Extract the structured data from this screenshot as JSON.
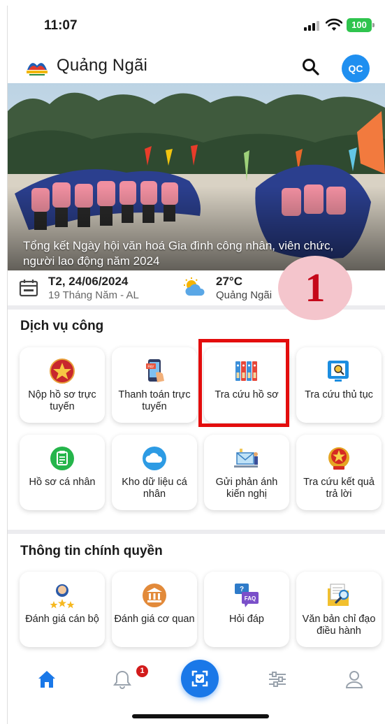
{
  "status_bar": {
    "time": "11:07",
    "battery": "100"
  },
  "header": {
    "title": "Quảng Ngãi",
    "avatar_initials": "QC"
  },
  "banner": {
    "caption": "Tổng kết Ngày hội văn hoá Gia đình công nhân, viên chức, người lao động năm 2024"
  },
  "info": {
    "date": "T2, 24/06/2024",
    "lunar_date": "19 Tháng Năm - AL",
    "temperature": "27°C",
    "location": "Quảng Ngãi"
  },
  "annotation": {
    "step_number": "1"
  },
  "public_services": {
    "title": "Dịch vụ công",
    "items": [
      {
        "label": "Nộp hồ sơ trực tuyến",
        "icon": "star-emblem-icon"
      },
      {
        "label": "Thanh toán trực tuyến",
        "icon": "phone-payment-icon"
      },
      {
        "label": "Tra cứu hồ sơ",
        "icon": "binders-icon"
      },
      {
        "label": "Tra cứu thủ tục",
        "icon": "document-search-icon"
      },
      {
        "label": "Hồ sơ cá nhân",
        "icon": "clipboard-icon"
      },
      {
        "label": "Kho dữ liệu cá nhân",
        "icon": "cloud-icon"
      },
      {
        "label": "Gửi phản ánh kiến nghị",
        "icon": "feedback-icon"
      },
      {
        "label": "Tra cứu kết quả trả lời",
        "icon": "national-emblem-icon"
      }
    ]
  },
  "gov_info": {
    "title": "Thông tin chính quyền",
    "items": [
      {
        "label": "Đánh giá cán bộ",
        "icon": "officer-rating-icon"
      },
      {
        "label": "Đánh giá cơ quan",
        "icon": "bank-building-icon"
      },
      {
        "label": "Hỏi đáp",
        "icon": "faq-icon"
      },
      {
        "label": "Văn bản chỉ đạo điều hành",
        "icon": "document-magnifier-icon"
      }
    ]
  },
  "bottom_nav": {
    "notification_count": "1"
  },
  "colors": {
    "primary": "#1a78e8",
    "highlight": "#e30d0d",
    "battery": "#2fc44e"
  }
}
